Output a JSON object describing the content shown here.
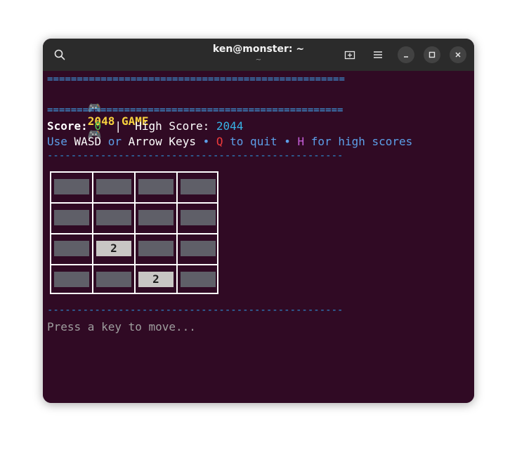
{
  "window": {
    "title": "ken@monster: ~",
    "subtitle": "~"
  },
  "terminal": {
    "separator_top": "==================================================",
    "game_icon": "🎮",
    "game_title": "2048 GAME",
    "separator_mid": "==================================================",
    "score_label": "Score:",
    "score_value": "0",
    "divider": "|",
    "high_score_label": "High Score:",
    "high_score_value": "2044",
    "help": {
      "use": "Use",
      "wasd": "WASD",
      "or": "or",
      "arrow_keys": "Arrow Keys",
      "bullet": "•",
      "q": "Q",
      "to_quit": "to quit",
      "h": "H",
      "for_high_scores": "for high scores"
    },
    "dashes_top": "--------------------------------------------------",
    "dashes_bottom": "--------------------------------------------------",
    "prompt": "Press a key to move..."
  },
  "board": {
    "rows": [
      [
        "",
        "",
        "",
        ""
      ],
      [
        "",
        "",
        "",
        ""
      ],
      [
        "",
        "2",
        "",
        ""
      ],
      [
        "",
        "",
        "2",
        ""
      ]
    ]
  },
  "colors": {
    "terminal_bg": "#300a24",
    "titlebar_bg": "#2b2b2b",
    "empty_tile": "#5f5f68",
    "filled_tile": "#c8c6c4"
  },
  "icons": [
    "search-icon",
    "new-tab-icon",
    "menu-icon",
    "minimize-icon",
    "maximize-icon",
    "close-icon",
    "gamepad-icon"
  ]
}
